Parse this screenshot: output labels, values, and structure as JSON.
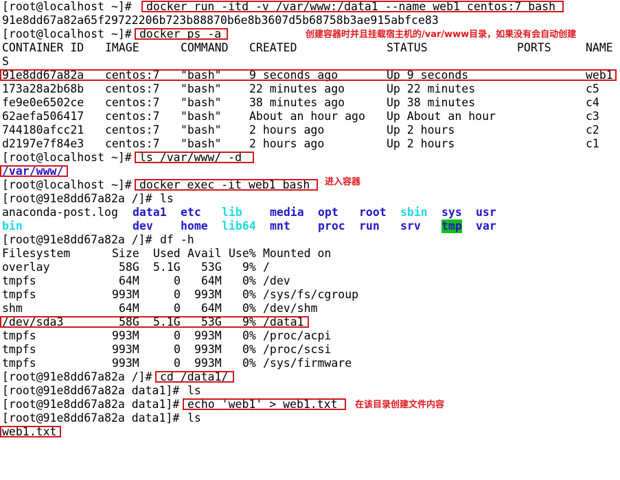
{
  "terminal": {
    "prompt_host": "[root@localhost ~]# ",
    "prompt_container_root": "[root@91e8dd67a82a /]# ",
    "prompt_container_data": "[root@91e8dd67a82a data1]# ",
    "cmd_run": "docker run -itd -v /var/www:/data1 --name web1 centos:7 bash",
    "container_id_full": "91e8dd67a82a65f29722206b723b88870b6e8b3607d5b68758b3ae915abfce83",
    "cmd_ps": "docker ps -a",
    "ps_headers": [
      "CONTAINER ID",
      "IMAGE",
      "COMMAND",
      "CREATED",
      "STATUS",
      "PORTS",
      "NAME"
    ],
    "ps_header_wrap": "S",
    "ps_rows": [
      [
        "91e8dd67a82a",
        "centos:7",
        "\"bash\"",
        "9 seconds ago",
        "Up 9 seconds",
        "",
        "web1"
      ],
      [
        "173a28a2b68b",
        "centos:7",
        "\"bash\"",
        "22 minutes ago",
        "Up 22 minutes",
        "",
        "c5"
      ],
      [
        "fe9e0e6502ce",
        "centos:7",
        "\"bash\"",
        "38 minutes ago",
        "Up 38 minutes",
        "",
        "c4"
      ],
      [
        "62aefa506417",
        "centos:7",
        "\"bash\"",
        "About an hour ago",
        "Up About an hour",
        "",
        "c3"
      ],
      [
        "744180afcc21",
        "centos:7",
        "\"bash\"",
        "2 hours ago",
        "Up 2 hours",
        "",
        "c2"
      ],
      [
        "d2197e7f84e3",
        "centos:7",
        "\"bash\"",
        "2 hours ago",
        "Up 2 hours",
        "",
        "c1"
      ]
    ],
    "cmd_ls_var": "ls /var/www/ -d",
    "ls_var_output": "/var/www/",
    "cmd_exec": "docker exec -it web1 bash",
    "cmd_ls": "ls",
    "ls_row1": [
      {
        "name": "anaconda-post.log",
        "style": "plain"
      },
      {
        "name": "data1",
        "style": "blue"
      },
      {
        "name": "etc",
        "style": "blue"
      },
      {
        "name": "lib",
        "style": "cyan"
      },
      {
        "name": "media",
        "style": "blue"
      },
      {
        "name": "opt",
        "style": "blue"
      },
      {
        "name": "root",
        "style": "blue"
      },
      {
        "name": "sbin",
        "style": "cyan"
      },
      {
        "name": "sys",
        "style": "blue"
      },
      {
        "name": "usr",
        "style": "blue"
      }
    ],
    "ls_row2": [
      {
        "name": "bin",
        "style": "cyan"
      },
      {
        "name": "dev",
        "style": "blue"
      },
      {
        "name": "home",
        "style": "blue"
      },
      {
        "name": "lib64",
        "style": "cyan"
      },
      {
        "name": "mnt",
        "style": "blue"
      },
      {
        "name": "proc",
        "style": "blue"
      },
      {
        "name": "run",
        "style": "blue"
      },
      {
        "name": "srv",
        "style": "blue"
      },
      {
        "name": "tmp",
        "style": "tmp"
      },
      {
        "name": "var",
        "style": "blue"
      }
    ],
    "cmd_df": "df -h",
    "df_headers": [
      "Filesystem",
      "Size",
      "Used",
      "Avail",
      "Use%",
      "Mounted on"
    ],
    "df_rows": [
      [
        "overlay",
        "58G",
        "5.1G",
        "53G",
        "9%",
        "/"
      ],
      [
        "tmpfs",
        "64M",
        "0",
        "64M",
        "0%",
        "/dev"
      ],
      [
        "tmpfs",
        "993M",
        "0",
        "993M",
        "0%",
        "/sys/fs/cgroup"
      ],
      [
        "shm",
        "64M",
        "0",
        "64M",
        "0%",
        "/dev/shm"
      ],
      [
        "/dev/sda3",
        "58G",
        "5.1G",
        "53G",
        "9%",
        "/data1"
      ],
      [
        "tmpfs",
        "993M",
        "0",
        "993M",
        "0%",
        "/proc/acpi"
      ],
      [
        "tmpfs",
        "993M",
        "0",
        "993M",
        "0%",
        "/proc/scsi"
      ],
      [
        "tmpfs",
        "993M",
        "0",
        "993M",
        "0%",
        "/sys/firmware"
      ]
    ],
    "cmd_cd": "cd /data1/",
    "cmd_echo": "echo 'web1' > web1.txt",
    "ls_final_output": "web1.txt"
  },
  "annotations": {
    "mount_note": "创建容器时并且挂载宿主机的/var/www目录，如果没有会自动创建",
    "exec_note": "进入容器",
    "echo_note": "在该目录创建文件内容"
  },
  "colors": {
    "annotation_red": "#e0181e",
    "dir_blue": "#2318c8",
    "symlink_cyan": "#20d8e0",
    "sticky_bg_green": "#16c016"
  }
}
